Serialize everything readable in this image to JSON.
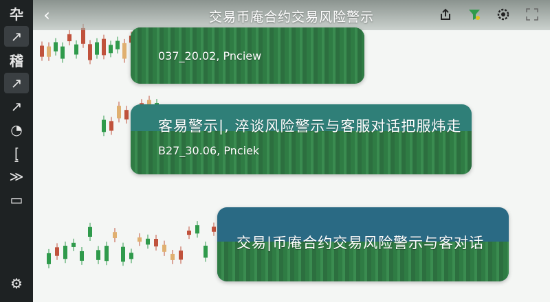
{
  "header": {
    "title": "交易币庵合约交易风险警示",
    "back_icon": "chevron-left-icon",
    "actions": [
      "share-icon",
      "filter-icon",
      "settings-icon",
      "expand-icon"
    ]
  },
  "sidebar": {
    "items": [
      {
        "name": "chart-type-icon",
        "glyph": "卆"
      },
      {
        "name": "draw-line-icon",
        "glyph": "↗"
      },
      {
        "name": "indicator-text",
        "glyph": "稽"
      },
      {
        "name": "ray-icon",
        "glyph": "↗"
      },
      {
        "name": "extend-line-icon",
        "glyph": "↗"
      },
      {
        "name": "measure-icon",
        "glyph": "◔"
      },
      {
        "name": "bracket-icon",
        "glyph": "⦋"
      },
      {
        "name": "arrow-icon",
        "glyph": "≫"
      },
      {
        "name": "frame-icon",
        "glyph": "▭"
      }
    ],
    "settings_icon": "gear-icon"
  },
  "messages": [
    {
      "text": "",
      "meta": "037_20.02, Pnciew"
    },
    {
      "text": "客易警示|, 淬谈风险警示与客服对话把服炜走",
      "meta": "B27_30.06, Pnciek"
    },
    {
      "text": "交易|币庵合约交易风险警示与客对话",
      "meta": ""
    }
  ],
  "colors": {
    "sidebar": "#1e2223",
    "bull": "#2f9a4b",
    "bear": "#c0523c",
    "card_green": "#3f7a52",
    "card_teal": "#2f7f78",
    "card_blue": "#2a6a84"
  }
}
